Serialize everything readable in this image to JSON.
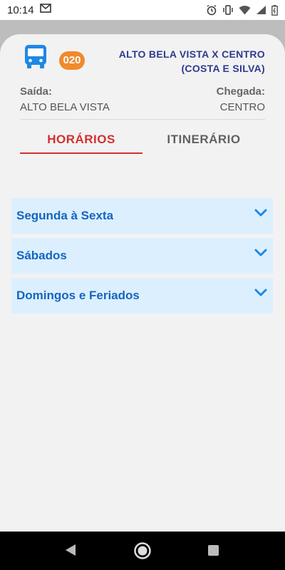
{
  "status_bar": {
    "time": "10:14",
    "icons": [
      "gmail-icon",
      "alarm-icon",
      "vibrate-icon",
      "wifi-icon",
      "signal-icon",
      "battery-icon"
    ]
  },
  "header": {
    "bus_icon": "bus-icon",
    "route_number": "020",
    "route_name_line1": "ALTO BELA VISTA X CENTRO",
    "route_name_line2": "(COSTA E SILVA)"
  },
  "trip": {
    "departure_label": "Saída:",
    "departure_value": "ALTO BELA VISTA",
    "arrival_label": "Chegada:",
    "arrival_value": "CENTRO"
  },
  "tabs": [
    {
      "label": "HORÁRIOS",
      "active": true
    },
    {
      "label": "ITINERÁRIO",
      "active": false
    }
  ],
  "schedules": [
    {
      "label": "Segunda à Sexta",
      "icon": "chevron-down-icon"
    },
    {
      "label": "Sábados",
      "icon": "chevron-down-icon"
    },
    {
      "label": "Domingos e Feriados",
      "icon": "chevron-down-icon"
    }
  ],
  "colors": {
    "accent_red": "#d32f2f",
    "badge_orange": "#f08a2c",
    "bus_blue": "#1e88e5",
    "route_title": "#2f3a8f",
    "accordion_bg": "#dcefff",
    "accordion_text": "#1565c0"
  },
  "nav": [
    "back-icon",
    "home-icon",
    "recents-icon"
  ]
}
